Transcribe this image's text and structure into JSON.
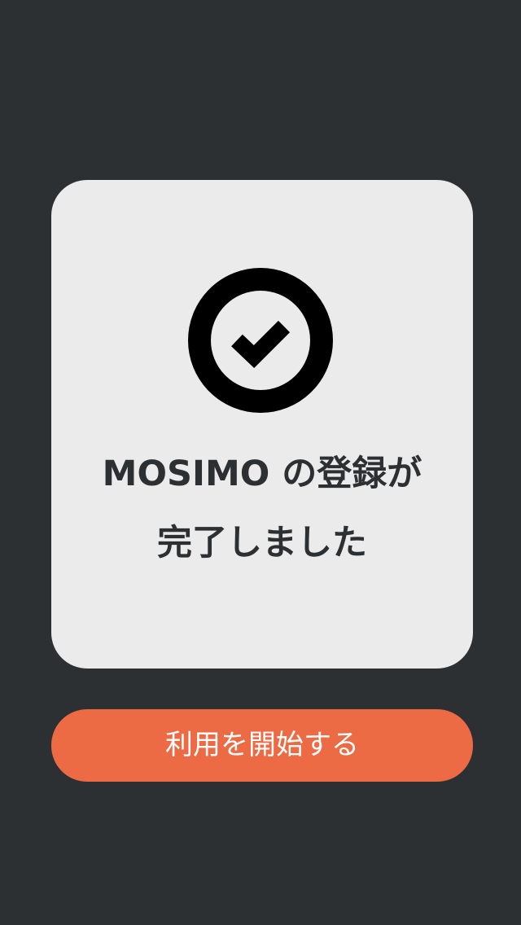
{
  "completion_card": {
    "icon": "check-circle-icon",
    "message_line1": "MOSIMO の登録が",
    "message_line2": "完了しました"
  },
  "start_button": {
    "label": "利用を開始する"
  },
  "colors": {
    "background": "#2d3033",
    "card": "#eaebea",
    "icon": "#000000",
    "accent": "#ec6a44",
    "text": "#2d3033"
  }
}
